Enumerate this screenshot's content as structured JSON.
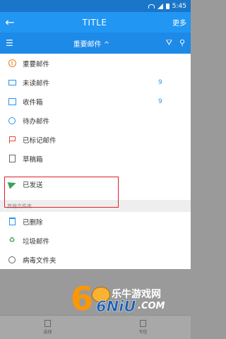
{
  "status_bar": {
    "time": "5:45"
  },
  "app_bar": {
    "back_icon": "arrow-left-icon",
    "title": "TITLE",
    "more_label": "更多"
  },
  "sub_bar": {
    "menu_icon": "hamburger-icon",
    "folder_label": "重要邮件 ^",
    "filter_icon": "filter-icon",
    "search_icon": "search-icon"
  },
  "folders": [
    {
      "label": "重要邮件",
      "icon": "important-icon",
      "count": ""
    },
    {
      "label": "未读邮件",
      "icon": "unread-icon",
      "count": "9"
    },
    {
      "label": "收件箱",
      "icon": "inbox-icon",
      "count": "9"
    },
    {
      "label": "待办邮件",
      "icon": "todo-icon",
      "count": ""
    },
    {
      "label": "已标记邮件",
      "icon": "flag-icon",
      "count": ""
    },
    {
      "label": "草稿箱",
      "icon": "draft-icon",
      "count": ""
    },
    {
      "label": "已发送",
      "icon": "sent-icon",
      "count": ""
    }
  ],
  "other_section": {
    "title": "其他文件夹"
  },
  "other_folders": [
    {
      "label": "已删除",
      "icon": "trash-icon"
    },
    {
      "label": "垃圾邮件",
      "icon": "junk-icon"
    },
    {
      "label": "病毒文件夹",
      "icon": "virus-icon"
    }
  ],
  "bottom_bar": {
    "items": [
      {
        "label": "选择"
      },
      {
        "label": "写信"
      }
    ]
  },
  "watermark": {
    "brand": "乐牛游戏网",
    "logo_text": "6NiU",
    "logo_domain": ".COM"
  },
  "colors": {
    "primary": "#2196f3",
    "highlight": "#e0202a"
  }
}
